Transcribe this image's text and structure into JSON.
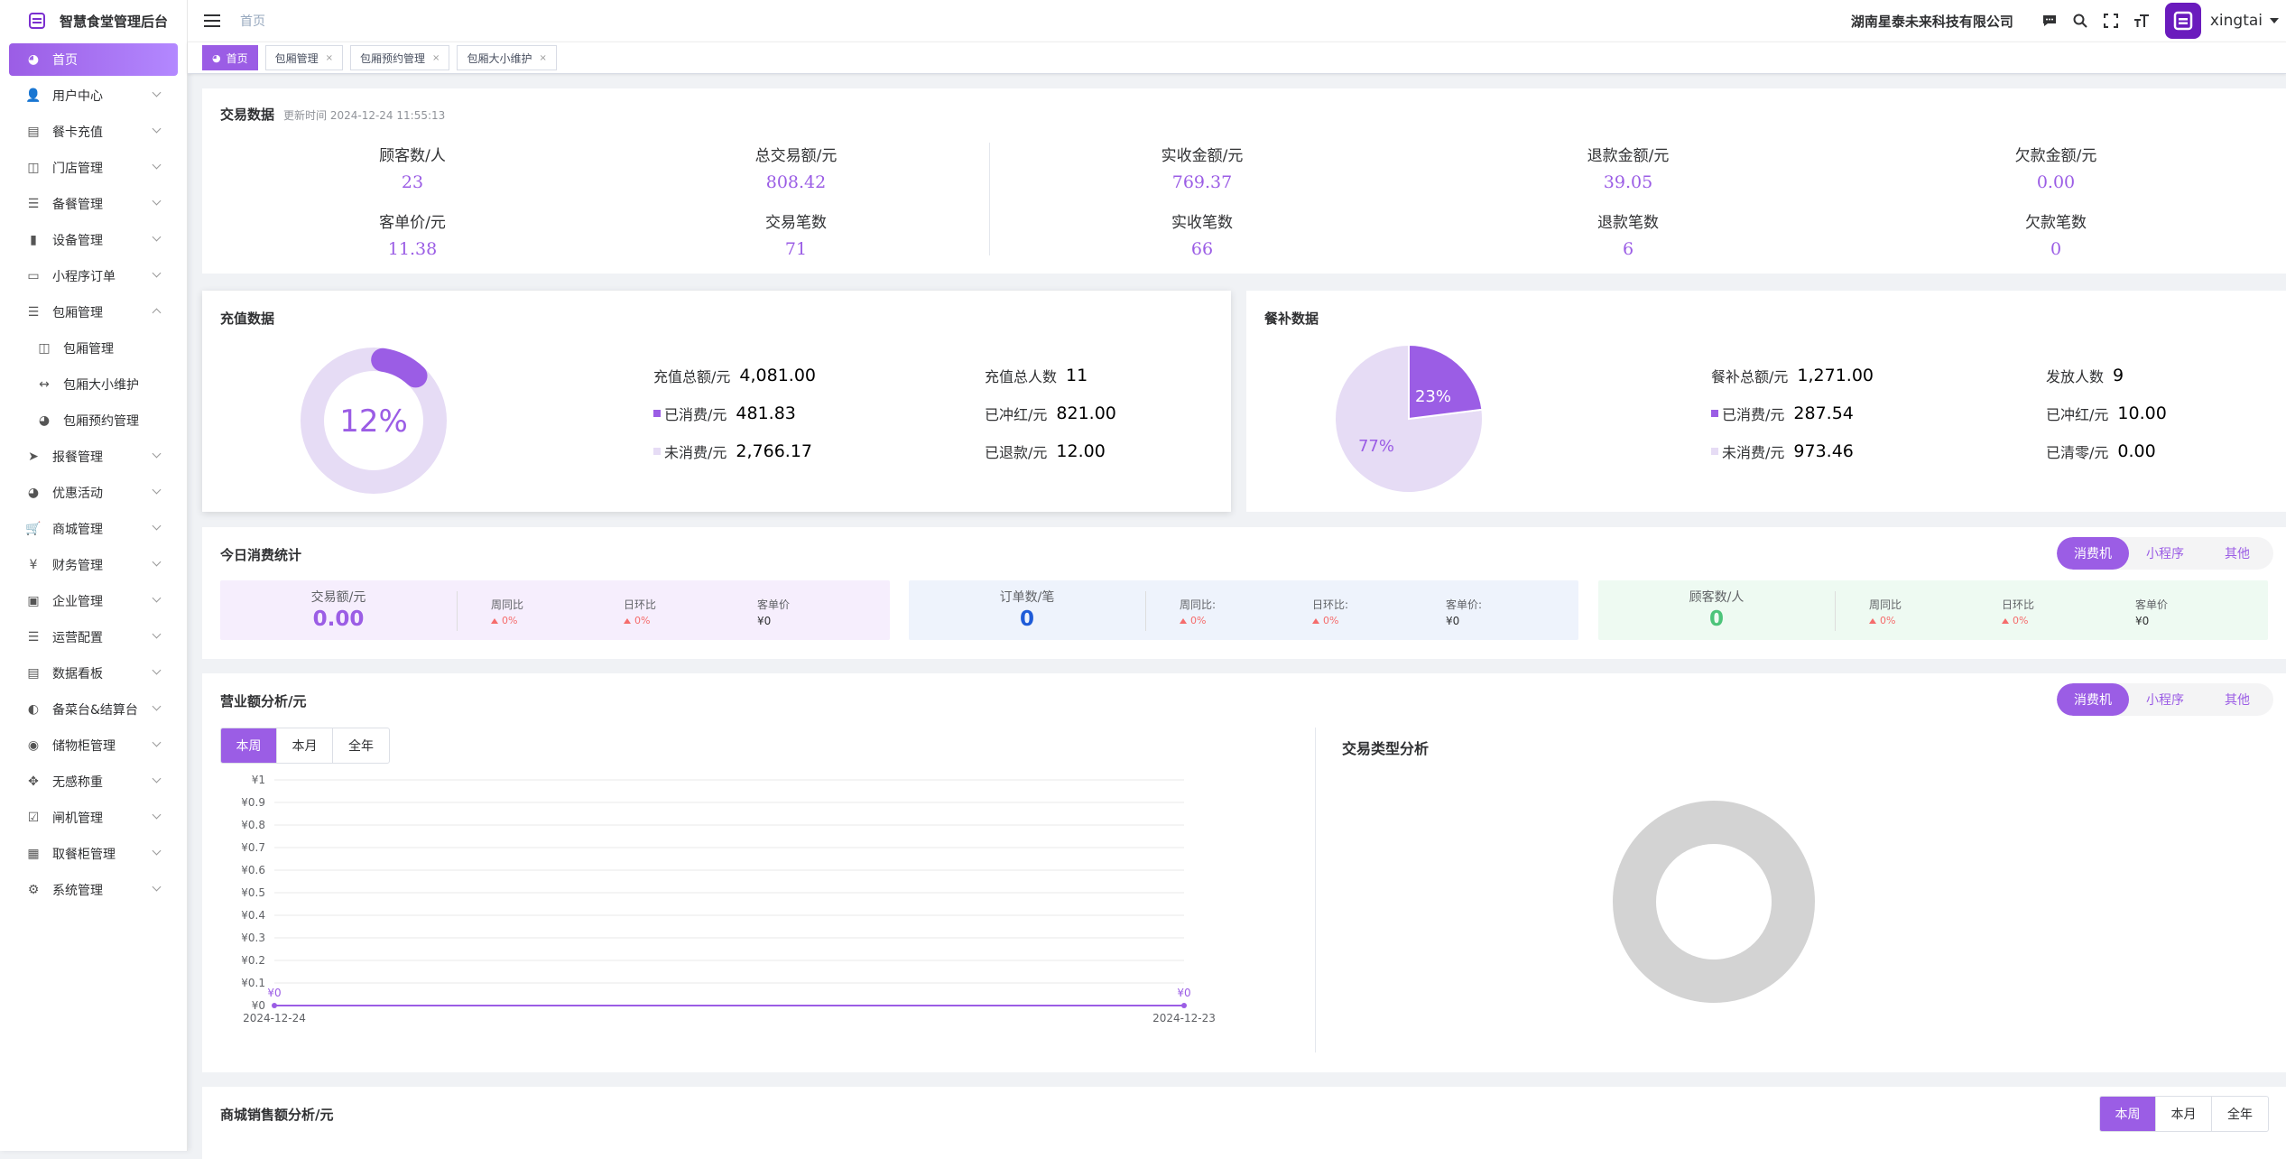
{
  "app": {
    "title": "智慧食堂管理后台"
  },
  "sidebar": {
    "items": [
      {
        "label": "首页"
      },
      {
        "label": "用户中心"
      },
      {
        "label": "餐卡充值"
      },
      {
        "label": "门店管理"
      },
      {
        "label": "备餐管理"
      },
      {
        "label": "设备管理"
      },
      {
        "label": "小程序订单"
      },
      {
        "label": "包厢管理"
      },
      {
        "label": "包厢管理"
      },
      {
        "label": "包厢大小维护"
      },
      {
        "label": "包厢预约管理"
      },
      {
        "label": "报餐管理"
      },
      {
        "label": "优惠活动"
      },
      {
        "label": "商城管理"
      },
      {
        "label": "财务管理"
      },
      {
        "label": "企业管理"
      },
      {
        "label": "运营配置"
      },
      {
        "label": "数据看板"
      },
      {
        "label": "备菜台&结算台"
      },
      {
        "label": "储物柜管理"
      },
      {
        "label": "无感称重"
      },
      {
        "label": "闸机管理"
      },
      {
        "label": "取餐柜管理"
      },
      {
        "label": "系统管理"
      }
    ]
  },
  "header": {
    "breadcrumb": "首页",
    "company": "湖南星泰未来科技有限公司",
    "username": "xingtai"
  },
  "tags": [
    {
      "label": "首页"
    },
    {
      "label": "包厢管理"
    },
    {
      "label": "包厢预约管理"
    },
    {
      "label": "包厢大小维护"
    }
  ],
  "transaction": {
    "title": "交易数据",
    "updated": "更新时间 2024-12-24 11:55:13",
    "metrics": [
      {
        "label": "顾客数/人",
        "value": "23"
      },
      {
        "label": "总交易额/元",
        "value": "808.42"
      },
      {
        "label": "实收金额/元",
        "value": "769.37"
      },
      {
        "label": "退款金额/元",
        "value": "39.05"
      },
      {
        "label": "欠款金额/元",
        "value": "0.00"
      },
      {
        "label": "客单价/元",
        "value": "11.38"
      },
      {
        "label": "交易笔数",
        "value": "71"
      },
      {
        "label": "实收笔数",
        "value": "66"
      },
      {
        "label": "退款笔数",
        "value": "6"
      },
      {
        "label": "欠款笔数",
        "value": "0"
      }
    ]
  },
  "recharge": {
    "title": "充值数据",
    "percent_label": "12%",
    "percent": 12,
    "rows": [
      {
        "label": "充值总额/元",
        "value": "4,081.00"
      },
      {
        "label": "已消费/元",
        "value": "481.83"
      },
      {
        "label": "未消费/元",
        "value": "2,766.17"
      },
      {
        "label": "充值总人数",
        "value": "11"
      },
      {
        "label": "已冲红/元",
        "value": "821.00"
      },
      {
        "label": "已退款/元",
        "value": "12.00"
      }
    ]
  },
  "subsidy": {
    "title": "餐补数据",
    "pie": [
      {
        "label": "23%",
        "value": 23
      },
      {
        "label": "77%",
        "value": 77
      }
    ],
    "rows": [
      {
        "label": "餐补总额/元",
        "value": "1,271.00"
      },
      {
        "label": "已消费/元",
        "value": "287.54"
      },
      {
        "label": "未消费/元",
        "value": "973.46"
      },
      {
        "label": "发放人数",
        "value": "9"
      },
      {
        "label": "已冲红/元",
        "value": "10.00"
      },
      {
        "label": "已清零/元",
        "value": "0.00"
      }
    ]
  },
  "today": {
    "title": "今日消费统计",
    "segments": [
      "消费机",
      "小程序",
      "其他"
    ],
    "boxes": [
      {
        "label": "交易额/元",
        "value": "0.00",
        "c1": "周同比",
        "v1": "0%",
        "c2": "日环比",
        "v2": "0%",
        "c3": "客单价",
        "v3": "¥0"
      },
      {
        "label": "订单数/笔",
        "value": "0",
        "c1": "周同比:",
        "v1": "0%",
        "c2": "日环比:",
        "v2": "0%",
        "c3": "客单价:",
        "v3": "¥0"
      },
      {
        "label": "顾客数/人",
        "value": "0",
        "c1": "周同比",
        "v1": "0%",
        "c2": "日环比",
        "v2": "0%",
        "c3": "客单价",
        "v3": "¥0"
      }
    ]
  },
  "revenue": {
    "title": "营业额分析/元",
    "segments": [
      "消费机",
      "小程序",
      "其他"
    ],
    "ranges": [
      "本周",
      "本月",
      "全年"
    ],
    "type_title": "交易类型分析"
  },
  "chart_data": {
    "type": "line",
    "x": [
      "2024-12-24",
      "2024-12-23"
    ],
    "series": [
      {
        "values": [
          0,
          0
        ]
      }
    ],
    "point_labels": [
      "¥0",
      "¥0"
    ],
    "yticks": [
      "¥0",
      "¥0.1",
      "¥0.2",
      "¥0.3",
      "¥0.4",
      "¥0.5",
      "¥0.6",
      "¥0.7",
      "¥0.8",
      "¥0.9",
      "¥1"
    ],
    "ylim": [
      0,
      1
    ],
    "grid": true,
    "color": "#9b5de5"
  },
  "mall": {
    "title": "商城销售额分析/元",
    "ranges": [
      "本周",
      "本月",
      "全年"
    ]
  },
  "colors": {
    "accent": "#9b5de5",
    "light": "#e6dcf5",
    "gray": "#d3d3d3"
  }
}
